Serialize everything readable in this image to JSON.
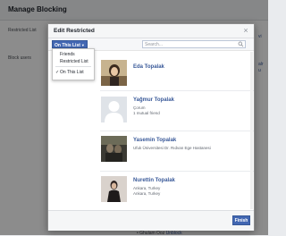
{
  "background": {
    "page_title": "Manage Blocking",
    "restricted_list_label": "Restricted List",
    "block_users_label": "Block users",
    "right_fragments": [
      "vi",
      "alr",
      "u"
    ],
    "bottom_link_name": "Ghulam Ooz",
    "bottom_link_action": "Unblock"
  },
  "modal": {
    "title": "Edit Restricted",
    "close_glyph": "×",
    "filter_label": "On This List",
    "search_placeholder": "Search...",
    "search_value": "",
    "dropdown": {
      "items": [
        "Friends",
        "Restricted List",
        "On This List"
      ],
      "selected_index": 2,
      "check_glyph": "✓"
    },
    "people": [
      {
        "name": "Eda Topalak",
        "lines": []
      },
      {
        "name": "Yağmur Topalak",
        "lines": [
          "Çorum",
          "1 mutual friend"
        ]
      },
      {
        "name": "Yasemin Topalak",
        "lines": [
          "Ufuk Üniversitesi Dr. Rıdvan Ege Hastanesi"
        ]
      },
      {
        "name": "Nurettin Topalak",
        "lines": [
          "Ankara, Turkey",
          "Ankara, Turkey"
        ]
      }
    ],
    "finish_label": "Finish"
  },
  "colors": {
    "brand_blue": "#4267b2",
    "link_blue": "#385898"
  }
}
